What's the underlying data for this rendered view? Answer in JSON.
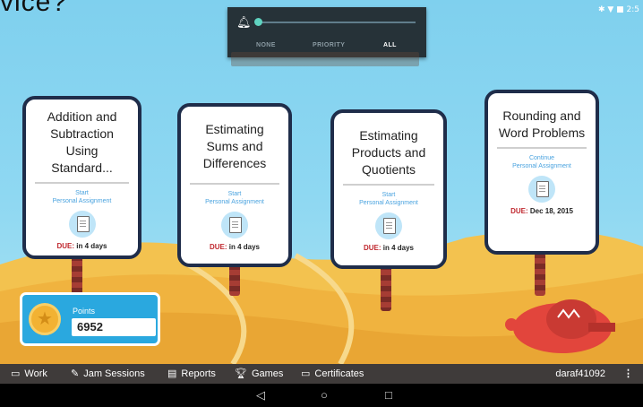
{
  "caption_fragment": "vice?",
  "status": {
    "time": "2:5",
    "icons": "✱ ▼ ■"
  },
  "notification_shade": {
    "options": [
      "NONE",
      "PRIORITY",
      "ALL"
    ],
    "selected": "ALL"
  },
  "cards": [
    {
      "title": "Addition and Subtraction Using Standard...",
      "action": "Start",
      "type": "Personal Assignment",
      "due_label": "DUE:",
      "due_value": "in 4 days"
    },
    {
      "title": "Estimating Sums and Differences",
      "action": "Start",
      "type": "Personal Assignment",
      "due_label": "DUE:",
      "due_value": "in 4 days"
    },
    {
      "title": "Estimating Products and Quotients",
      "action": "Start",
      "type": "Personal Assignment",
      "due_label": "DUE:",
      "due_value": "in 4 days"
    },
    {
      "title": "Rounding and Word Problems",
      "action": "Continue",
      "type": "Personal Assignment",
      "due_label": "DUE:",
      "due_value": "Dec 18, 2015"
    }
  ],
  "points": {
    "label": "Points",
    "value": "6952"
  },
  "nav": {
    "items": [
      {
        "label": "Work",
        "icon": "monitor-icon"
      },
      {
        "label": "Jam Sessions",
        "icon": "edit-icon"
      },
      {
        "label": "Reports",
        "icon": "report-icon"
      },
      {
        "label": "Games",
        "icon": "trophy-icon"
      },
      {
        "label": "Certificates",
        "icon": "certificate-icon"
      }
    ],
    "user": "daraf41092"
  },
  "colors": {
    "sky": "#8fd8f2",
    "card_border": "#1f2d4a",
    "due_red": "#c0282f",
    "points_blue": "#2aa8df",
    "nav_bg": "#3f3b3a"
  }
}
